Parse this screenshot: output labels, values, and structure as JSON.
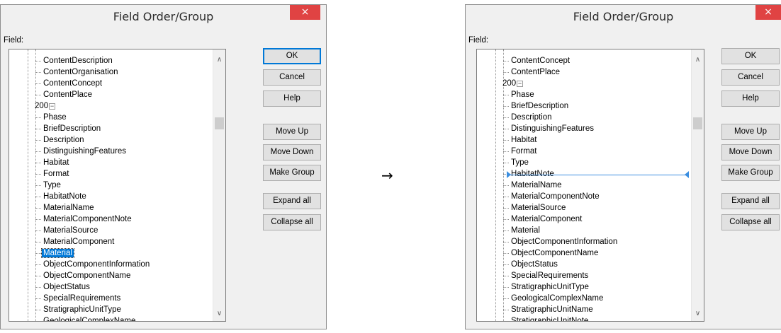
{
  "arrow": "→",
  "left": {
    "title": "Field Order/Group",
    "close": "×",
    "field_label": "Field:",
    "group_label": "200",
    "items_before": [
      "ContentDescription",
      "ContentOrganisation",
      "ContentConcept",
      "ContentPlace"
    ],
    "items_group": [
      "Phase",
      "BriefDescription",
      "Description",
      "DistinguishingFeatures",
      "Habitat",
      "Format",
      "Type",
      "HabitatNote",
      "MaterialName",
      "MaterialComponentNote",
      "MaterialSource",
      "MaterialComponent",
      "Material",
      "ObjectComponentInformation",
      "ObjectComponentName",
      "ObjectStatus",
      "SpecialRequirements",
      "StratigraphicUnitType",
      "GeologicalComplexName"
    ],
    "selected": "Material",
    "buttons": {
      "ok": "OK",
      "cancel": "Cancel",
      "help": "Help",
      "move_up": "Move Up",
      "move_down": "Move Down",
      "make_group": "Make Group",
      "expand_all": "Expand all",
      "collapse_all": "Collapse all"
    },
    "scroll_arrow_up": "∧",
    "scroll_arrow_down": "∨"
  },
  "right": {
    "title": "Field Order/Group",
    "close": "×",
    "field_label": "Field:",
    "group_label": "200",
    "items_before": [
      "ContentConcept",
      "ContentPlace"
    ],
    "items_group": [
      "Phase",
      "BriefDescription",
      "Description",
      "DistinguishingFeatures",
      "Habitat",
      "Format",
      "Type",
      "HabitatNote",
      "MaterialName",
      "MaterialComponentNote",
      "MaterialSource",
      "MaterialComponent",
      "Material",
      "ObjectComponentInformation",
      "ObjectComponentName",
      "ObjectStatus",
      "SpecialRequirements",
      "StratigraphicUnitType",
      "GeologicalComplexName",
      "StratigraphicUnitName",
      "StratigraphicUnitNote"
    ],
    "buttons": {
      "ok": "OK",
      "cancel": "Cancel",
      "help": "Help",
      "move_up": "Move Up",
      "move_down": "Move Down",
      "make_group": "Make Group",
      "expand_all": "Expand all",
      "collapse_all": "Collapse all"
    },
    "scroll_arrow_up": "∧",
    "scroll_arrow_down": "∨"
  },
  "colors": {
    "selection": "#0078d7",
    "drop_indicator": "#3b8ee0",
    "close": "#e04343"
  }
}
